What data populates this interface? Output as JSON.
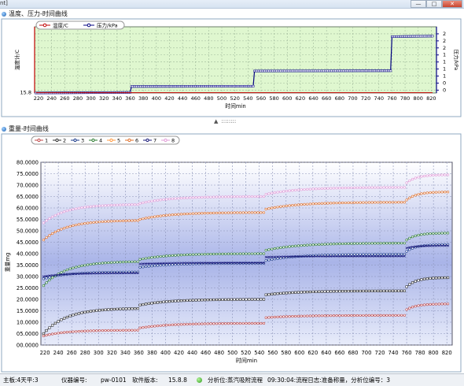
{
  "window": {
    "app_label": "nt]",
    "controls": {
      "minimize": "—",
      "maximize": "□",
      "close": "✕"
    }
  },
  "top_panel": {
    "title": "温度、压力-时间曲线"
  },
  "bottom_panel": {
    "title": "重量-时间曲线"
  },
  "splitter": {
    "arrow": "▲",
    "grip": "::::::::"
  },
  "statusbar": {
    "board": "主板:4天平:3",
    "device_label": "仪器编号:",
    "device_value": "pw-0101",
    "version_label": "软件版本:",
    "version_value": "15.8.8",
    "analysis": "分析位:蒸汽吸附流程",
    "log": "09:30:04:流程日志:准备称量，分析位编号：3"
  },
  "colors": {
    "panel_bg": "#dff7cf",
    "grid": "#9fb89a",
    "plot_top": "#ffffff",
    "plot_bottom": "#a9b4e8",
    "left_axis": "#c00000",
    "right_axis": "#000080"
  },
  "chart_data": [
    {
      "type": "line",
      "title": "",
      "xlabel": "时间min",
      "ylabel_left": "温度计/C",
      "ylabel_right": "压力/kPa",
      "xlim": [
        214,
        828
      ],
      "x_ticks": [
        220,
        240,
        260,
        280,
        300,
        320,
        340,
        360,
        380,
        400,
        420,
        440,
        460,
        480,
        500,
        520,
        540,
        560,
        580,
        600,
        620,
        640,
        660,
        680,
        700,
        720,
        740,
        760,
        780,
        800,
        820
      ],
      "left_tick_labels": [
        "15.8"
      ],
      "right_ticks": [
        0,
        0.5,
        1,
        1.5,
        2
      ],
      "right_tick_labels": [
        "0",
        "0",
        "1",
        "1",
        "1",
        "1",
        "2",
        "2",
        "2"
      ],
      "legend": [
        {
          "name": "温度/C",
          "color": "#c00000"
        },
        {
          "name": "压力/kPa",
          "color": "#000080"
        }
      ],
      "series": [
        {
          "name": "温度/C",
          "color": "#c00000",
          "values": [
            [
              216,
              0.01
            ],
            [
              822,
              0.01
            ]
          ]
        },
        {
          "name": "压力/kPa",
          "color": "#000080",
          "x": [
            216,
            360,
            362,
            548,
            550,
            758,
            760,
            822
          ],
          "values": [
            0.0,
            0.02,
            0.23,
            0.24,
            0.78,
            0.79,
            2.0,
            2.02
          ]
        }
      ]
    },
    {
      "type": "line",
      "title": "",
      "xlabel": "时间min",
      "ylabel": "重量mg",
      "xlim": [
        214,
        828
      ],
      "ylim": [
        0,
        80
      ],
      "grid": true,
      "legend_placement": "top-left",
      "x_ticks": [
        220,
        240,
        260,
        280,
        300,
        320,
        340,
        360,
        380,
        400,
        420,
        440,
        460,
        480,
        500,
        520,
        540,
        560,
        580,
        600,
        620,
        640,
        660,
        680,
        700,
        720,
        740,
        760,
        780,
        800,
        820
      ],
      "y_ticks": [
        "00.0000",
        "05.0000",
        "10.0000",
        "15.0000",
        "20.0000",
        "25.0000",
        "30.0000",
        "35.0000",
        "40.0000",
        "45.0000",
        "50.0000",
        "55.0000",
        "60.0000",
        "65.0000",
        "70.0000",
        "75.0000",
        "80.0000"
      ],
      "breaks": [
        360,
        548,
        758
      ],
      "series": [
        {
          "name": "1",
          "color": "#c04848",
          "seg": [
            [
              4.0,
              6.5
            ],
            [
              7.5,
              9.5
            ],
            [
              12.0,
              13.0
            ],
            [
              15.5,
              18.0
            ]
          ]
        },
        {
          "name": "2",
          "color": "#303030",
          "seg": [
            [
              5.0,
              16.0
            ],
            [
              17.5,
              20.0
            ],
            [
              22.0,
              23.7
            ],
            [
              25.5,
              29.5
            ]
          ]
        },
        {
          "name": "3",
          "color": "#1a3a8a",
          "seg": [
            [
              29.0,
              32.0
            ],
            [
              34.0,
              35.8
            ],
            [
              37.0,
              39.8
            ],
            [
              41.0,
              44.0
            ]
          ]
        },
        {
          "name": "4",
          "color": "#2e7d32",
          "seg": [
            [
              26.0,
              36.5
            ],
            [
              37.5,
              40.0
            ],
            [
              41.5,
              44.6
            ],
            [
              46.0,
              49.0
            ]
          ]
        },
        {
          "name": "5",
          "color": "#ff9a40",
          "seg": [
            [
              0,
              0
            ],
            [
              0,
              0
            ],
            [
              0,
              0
            ],
            [
              0,
              0
            ]
          ]
        },
        {
          "name": "6",
          "color": "#e0702a",
          "seg": [
            [
              46.0,
              54.5
            ],
            [
              55.0,
              58.0
            ],
            [
              59.5,
              62.5
            ],
            [
              63.5,
              67.0
            ]
          ]
        },
        {
          "name": "7",
          "color": "#1a1a7a",
          "seg": [
            [
              30.0,
              31.5
            ],
            [
              35.5,
              36.0
            ],
            [
              38.5,
              38.9
            ],
            [
              42.5,
              43.5
            ]
          ]
        },
        {
          "name": "8",
          "color": "#e29cd8",
          "seg": [
            [
              53.5,
              61.5
            ],
            [
              62.0,
              65.0
            ],
            [
              66.0,
              69.0
            ],
            [
              71.0,
              74.5
            ]
          ]
        }
      ]
    }
  ]
}
